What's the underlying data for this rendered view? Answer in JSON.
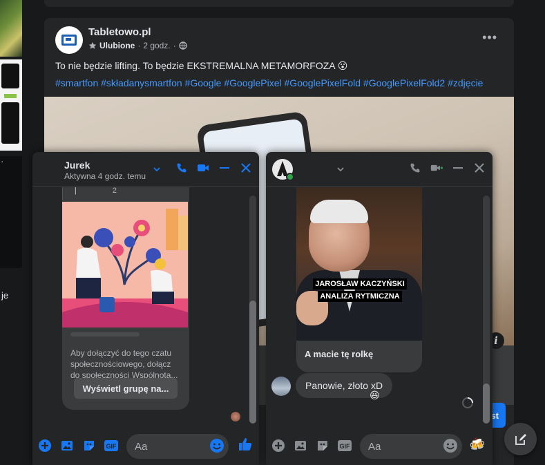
{
  "post": {
    "author": "Tabletowo.pl",
    "favorite_label": "Ulubione",
    "time": "2 godz.",
    "text": "To nie będzie lifting. To będzie EKSTREMALNA METAMORFOZA 😮",
    "hashtags": "#smartfon #składanysmartfon #Google #GooglePixel #GooglePixelFold #GooglePixelFold2 #zdjęcie",
    "more_label": "•••"
  },
  "left": {
    "partial_text": "je"
  },
  "chat1": {
    "name": "Jurek",
    "status": "Aktywna 4 godz. temu",
    "card_text": "Aby dołączyć do tego czatu społecznościowego, dołącz do społeczności Wspólnota...",
    "card_button": "Wyświetl grupę na...",
    "input_placeholder": "Aa"
  },
  "chat2": {
    "video_caption_line1": "JAROSŁAW KACZYŃSKI",
    "video_caption_line2": "ANALIZA RYTMICZNA",
    "video_message": "A macie tę rolkę",
    "reply": "Panowie, złoto xD",
    "reaction": "😆",
    "input_placeholder": "Aa",
    "send_emoji": "🍻"
  },
  "behind": {
    "button_fragment": "st",
    "info_icon": "i"
  },
  "colors": {
    "accent": "#1877f2",
    "background": "#18191a",
    "surface": "#242526",
    "link": "#4599ff"
  }
}
